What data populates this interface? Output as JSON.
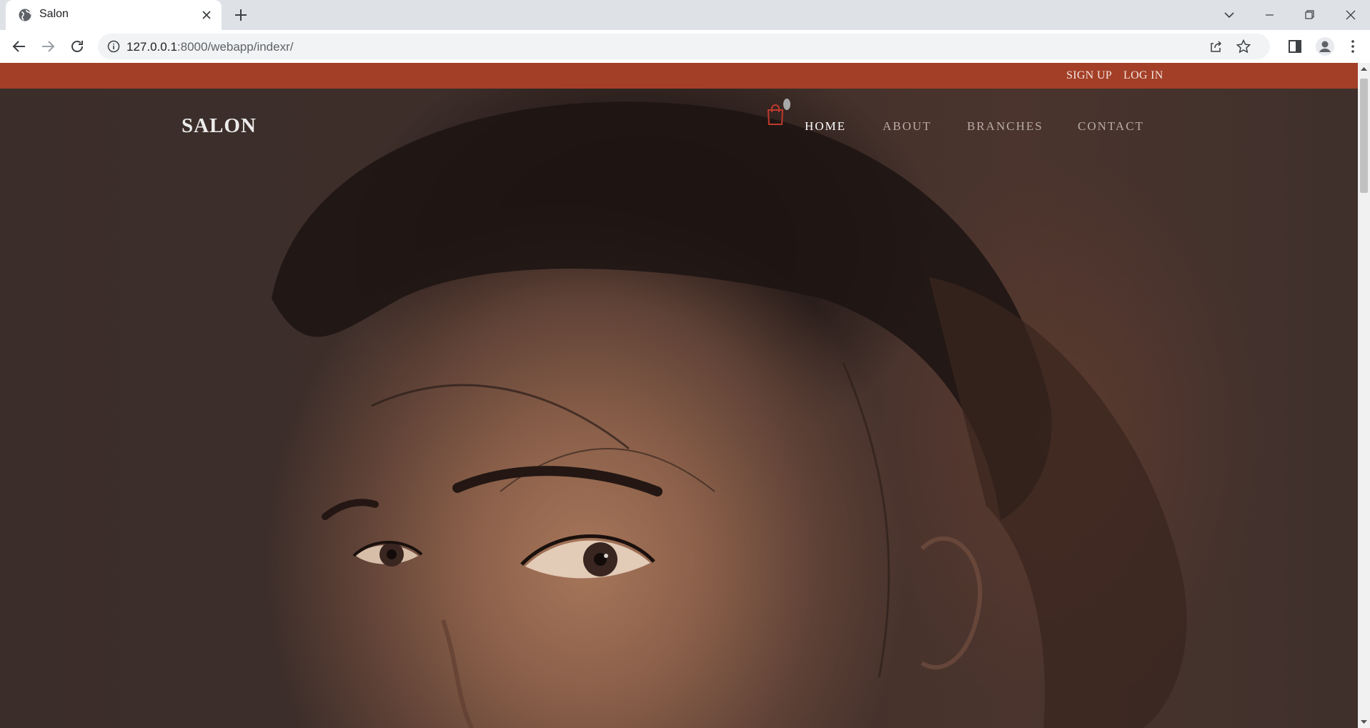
{
  "browser": {
    "tab_title": "Salon",
    "url_host": "127.0.0.1",
    "url_rest": ":8000/webapp/indexr/"
  },
  "site": {
    "topbar": {
      "signup": "SIGN UP",
      "login": "LOG IN",
      "color": "#a33f27"
    },
    "logo": "SALON",
    "nav": {
      "home": "HOME",
      "about": "ABOUT",
      "branches": "BRANCHES",
      "contact": "CONTACT"
    },
    "accent": "#c0392b"
  },
  "icons": [
    "globe-icon",
    "close-icon",
    "plus-icon",
    "chevron-down-icon",
    "minimize-icon",
    "restore-icon",
    "back-icon",
    "forward-icon",
    "reload-icon",
    "info-icon",
    "share-icon",
    "star-icon",
    "side-panel-icon",
    "profile-icon",
    "menu-icon",
    "shopping-bag-icon"
  ]
}
